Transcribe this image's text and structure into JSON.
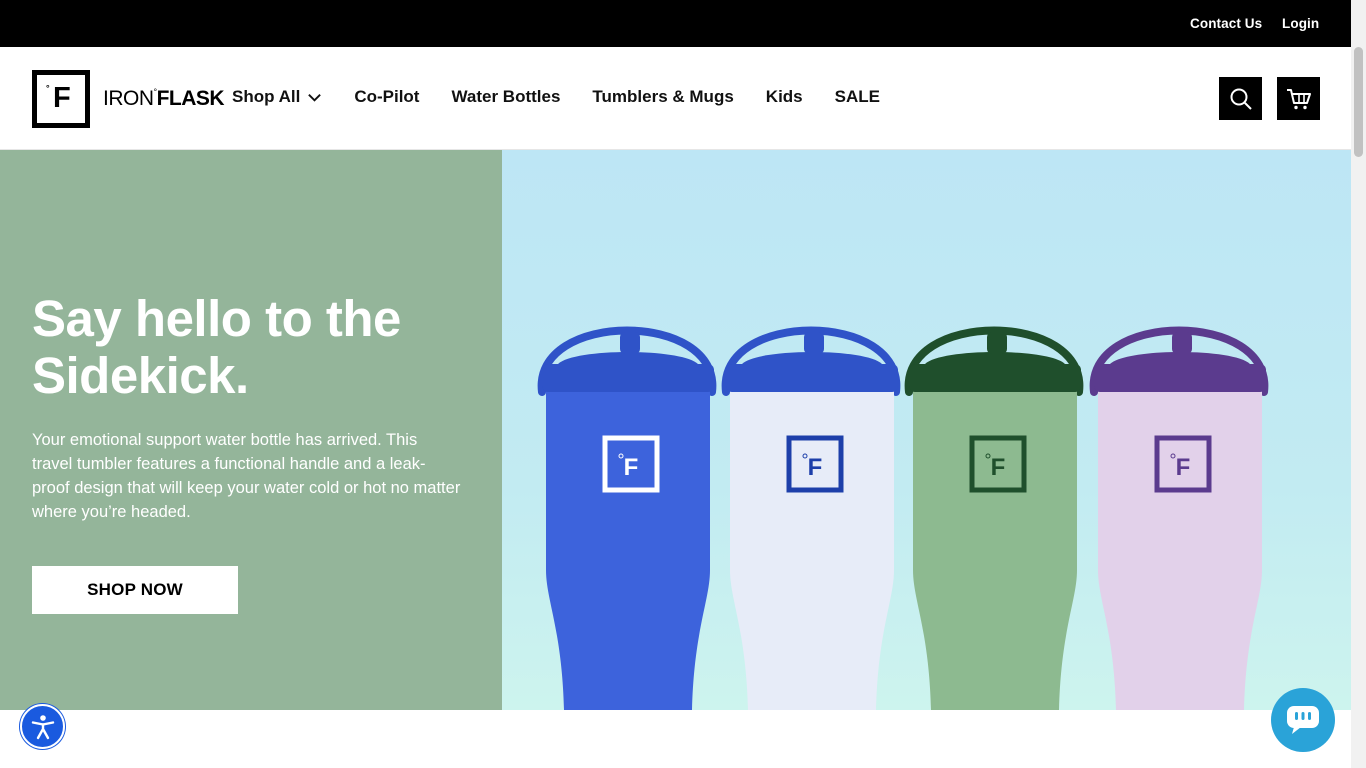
{
  "topbar": {
    "contact_label": "Contact Us",
    "login_label": "Login"
  },
  "header": {
    "logo_text_light": "IRON",
    "logo_text_bold": "FLASK",
    "logo_mark": "F",
    "nav": [
      {
        "label": "Shop All",
        "has_dropdown": true
      },
      {
        "label": "Co-Pilot"
      },
      {
        "label": "Water Bottles"
      },
      {
        "label": "Tumblers & Mugs"
      },
      {
        "label": "Kids"
      },
      {
        "label": "SALE"
      }
    ],
    "icons": [
      "search-icon",
      "cart-icon"
    ]
  },
  "hero": {
    "title": "Say hello to the Sidekick.",
    "description": "Your emotional support water bottle has arrived. This travel tumbler features a functional handle and a leak-proof design that will keep your water cold or hot no matter where you’re headed.",
    "cta_label": "SHOP NOW",
    "tumblers": [
      {
        "body": "#3d63dc",
        "lid": "#2f53c8",
        "handle": "#2f53c8",
        "badge": "#ffffff"
      },
      {
        "body": "#e7ecf8",
        "lid": "#2f53c8",
        "handle": "#2f53c8",
        "badge": "#1d3faa"
      },
      {
        "body": "#8dba90",
        "lid": "#1f4f2c",
        "handle": "#1f4f2c",
        "badge": "#1f4f2c"
      },
      {
        "body": "#e2d1ea",
        "lid": "#5b3b8e",
        "handle": "#5b3b8e",
        "badge": "#5b3b8e"
      }
    ],
    "left_bg": "#94b59a"
  },
  "widgets": {
    "accessibility_icon": "accessibility-icon",
    "chat_icon": "chat-icon",
    "accessibility_color": "#1a5adf",
    "chat_color": "#2aa3d8"
  }
}
